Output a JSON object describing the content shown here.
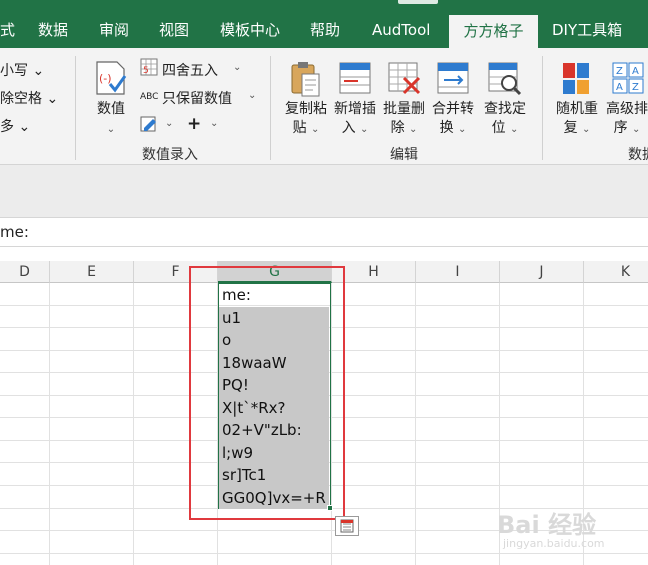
{
  "tabs": [
    {
      "label": "式",
      "active": false
    },
    {
      "label": "数据",
      "active": false
    },
    {
      "label": "审阅",
      "active": false
    },
    {
      "label": "视图",
      "active": false
    },
    {
      "label": "模板中心",
      "active": false
    },
    {
      "label": "帮助",
      "active": false
    },
    {
      "label": "AudTool",
      "active": false
    },
    {
      "label": "方方格子",
      "active": true
    },
    {
      "label": "DIY工具箱",
      "active": false
    }
  ],
  "ribbon": {
    "left_partial": {
      "item1": "小写 ⌄",
      "item2": "除空格 ⌄",
      "item3": "多 ⌄"
    },
    "numeric_entry": {
      "value_button": "数值",
      "round_label": "四舍五入",
      "keep_numeric_label": "只保留数值",
      "group_label": "数值录入"
    },
    "edit": {
      "copy_paste_line1": "复制粘",
      "copy_paste_line2": "贴",
      "insert_line1": "新增插",
      "insert_line2": "入",
      "batch_delete_line1": "批量删",
      "batch_delete_line2": "除",
      "merge_line1": "合并转",
      "merge_line2": "换",
      "find_line1": "查找定",
      "find_line2": "位",
      "group_label": "编辑"
    },
    "right_partial": {
      "random_line1": "随机重",
      "random_line2": "复",
      "sort_line1": "高级排",
      "sort_line2": "序",
      "group_label": "数据"
    }
  },
  "formula_bar": {
    "value": "me:"
  },
  "columns": [
    "D",
    "E",
    "F",
    "G",
    "H",
    "I",
    "J",
    "K"
  ],
  "selected_column": "G",
  "cells_G": [
    "me:",
    "u1",
    "o",
    "18waaW",
    "PQ!",
    "X|t`*Rx?",
    "02+V\"zLb:",
    "l;w9",
    "sr]Tc1",
    "GG0Q]vx=+R"
  ],
  "watermark": {
    "main": "Bai 经验",
    "sub": "jingyan.baidu.com"
  },
  "colors": {
    "ribbon_green": "#217346",
    "highlight_red": "#e0393e",
    "selected_fill": "#c8c8c8"
  }
}
